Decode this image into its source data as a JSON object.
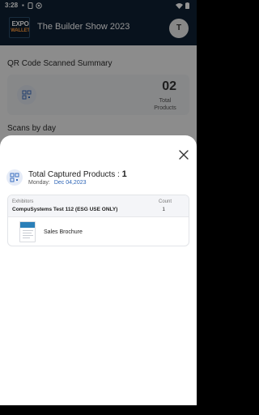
{
  "status_bar": {
    "time": "3:28",
    "icons": [
      "sim-icon",
      "notification-icon",
      "cast-icon",
      "wifi-icon",
      "battery-icon"
    ]
  },
  "app_bar": {
    "logo": {
      "line1": "EXPO",
      "line2": "WALLET"
    },
    "title": "The Builder Show 2023",
    "avatar_initial": "T"
  },
  "summary": {
    "section_title": "QR Code Scanned Summary",
    "total_products_value": "02",
    "total_products_label": "Total Products"
  },
  "scans_by_day": {
    "section_title": "Scans by day"
  },
  "sheet": {
    "title": "Total Captured Products : ",
    "count": "1",
    "day": "Monday:",
    "date": "Dec 04,2023",
    "table": {
      "headers": {
        "exhibitors": "Exhibitors",
        "count": "Count"
      },
      "exhibitor": {
        "name": "CompuSystems Test 112 (ESG USE ONLY)",
        "count": "1"
      },
      "products": [
        {
          "name": "Sales Brochure"
        }
      ]
    }
  },
  "colors": {
    "app_bar_bg": "#0e1f33",
    "accent_date": "#2b63b5",
    "logo_accent": "#ff9a3c"
  }
}
